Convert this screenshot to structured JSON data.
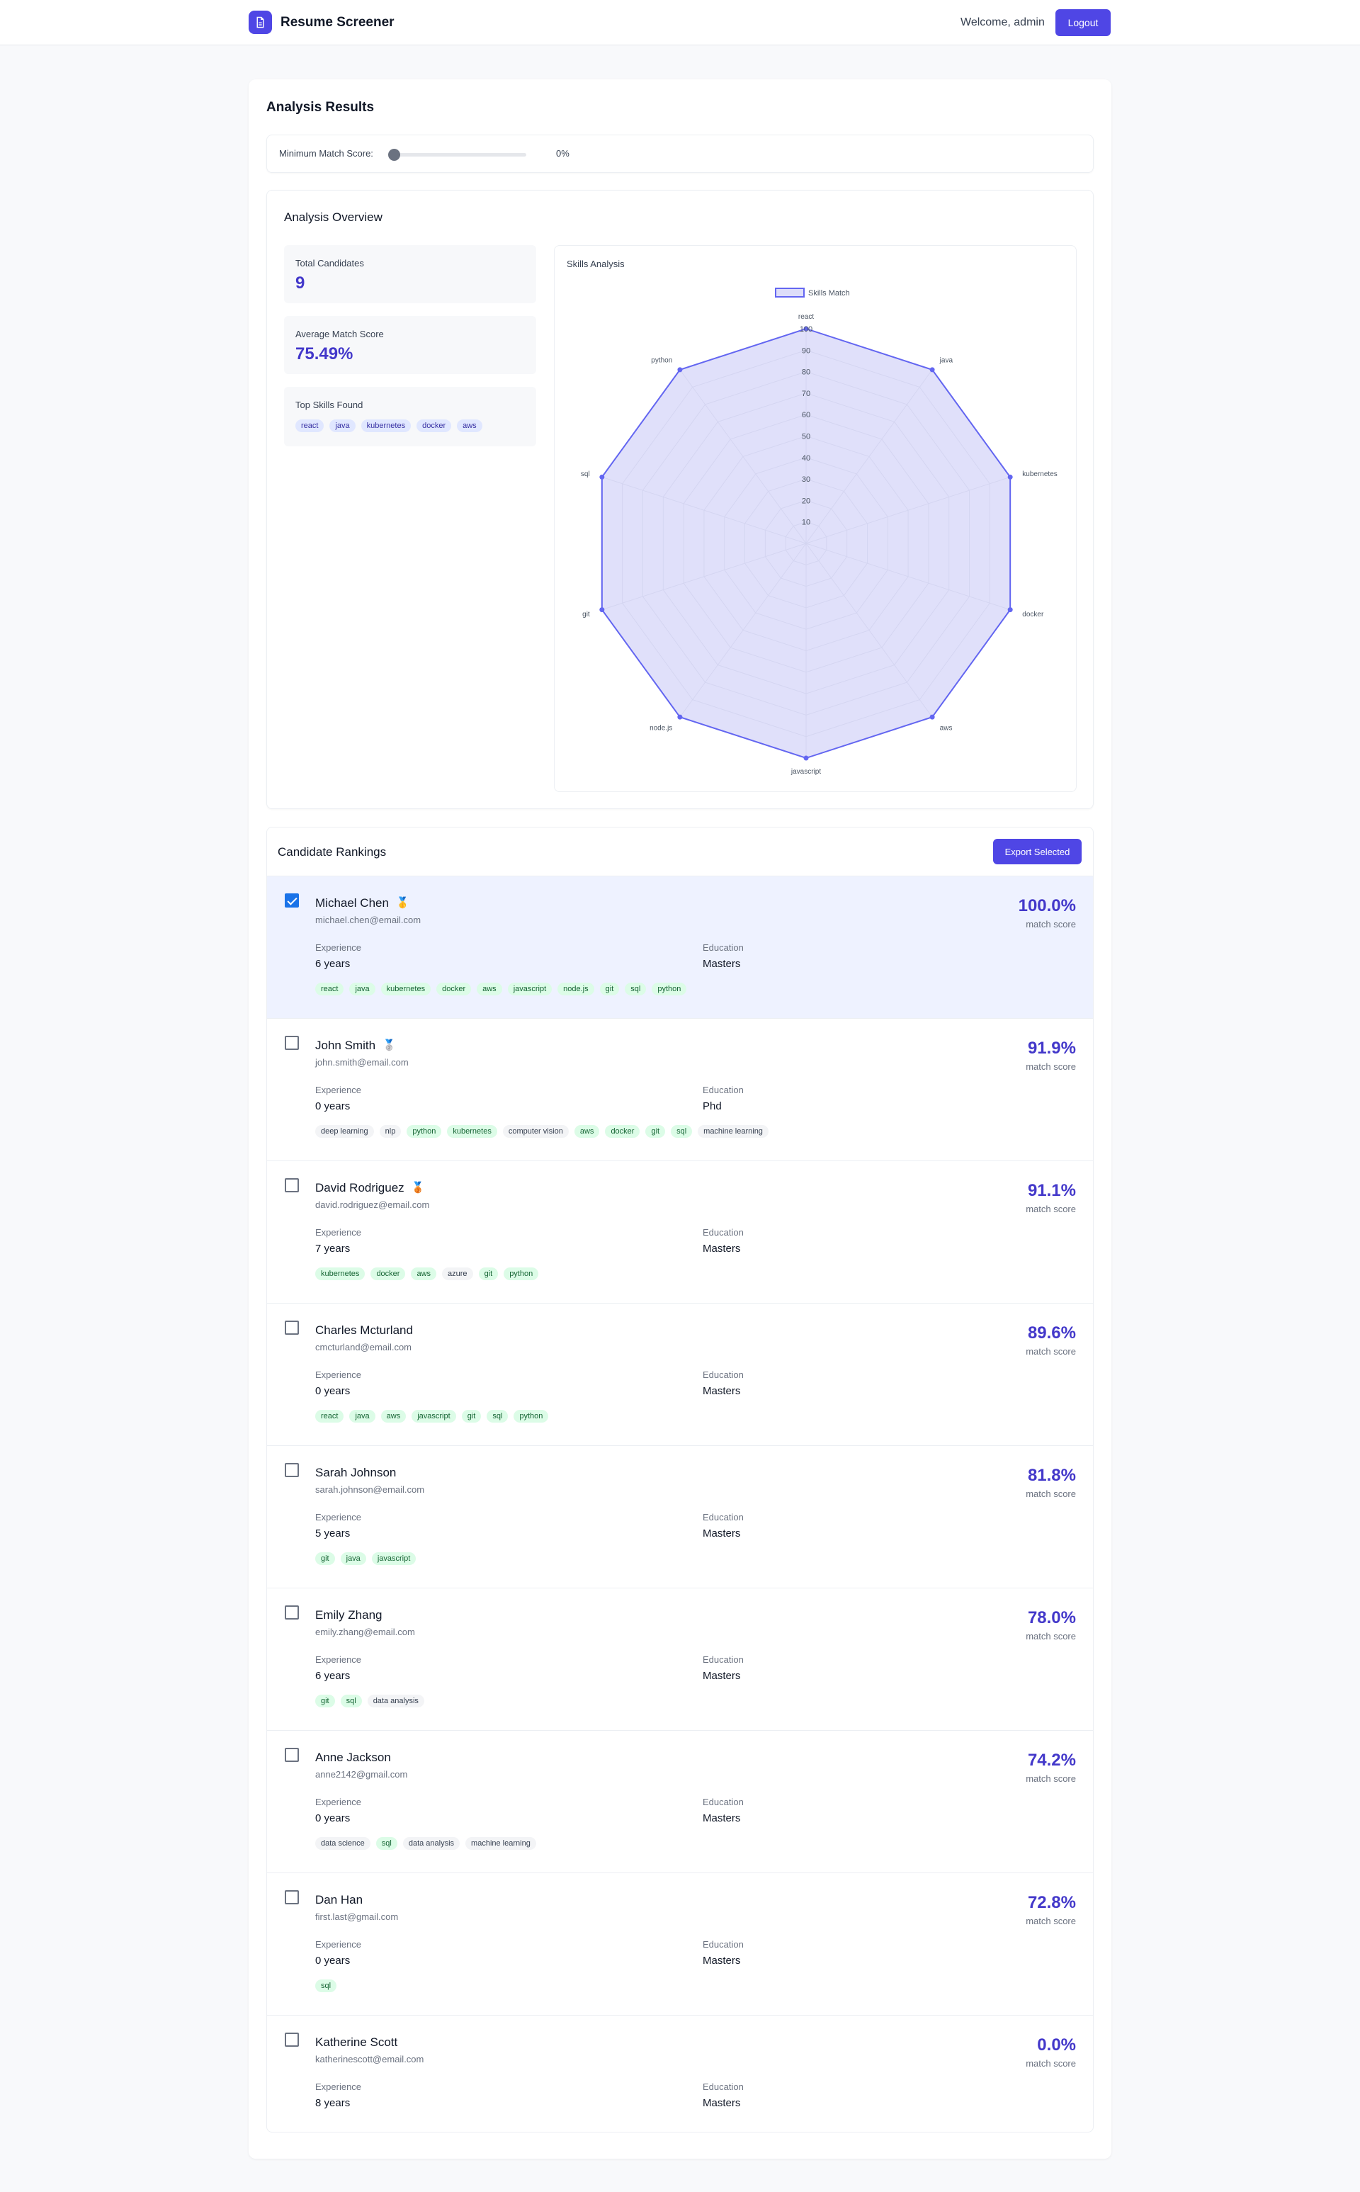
{
  "header": {
    "app_name": "Resume Screener",
    "welcome": "Welcome, admin",
    "logout_label": "Logout"
  },
  "main": {
    "title": "Analysis Results"
  },
  "filter": {
    "label": "Minimum Match Score:",
    "value_text": "0%",
    "value": 0
  },
  "overview": {
    "title": "Analysis Overview",
    "total_label": "Total Candidates",
    "total_value": "9",
    "avg_label": "Average Match Score",
    "avg_value": "75.49%",
    "skills_label": "Top Skills Found",
    "top_skills": [
      "react",
      "java",
      "kubernetes",
      "docker",
      "aws"
    ]
  },
  "chart_title": "Skills Analysis",
  "chart_data": {
    "type": "radar",
    "categories": [
      "react",
      "java",
      "kubernetes",
      "docker",
      "aws",
      "javascript",
      "node.js",
      "git",
      "sql",
      "python"
    ],
    "series": [
      {
        "name": "Skills Match",
        "values": [
          100,
          100,
          100,
          100,
          100,
          100,
          100,
          100,
          100,
          100
        ]
      }
    ],
    "ticks": [
      "10",
      "20",
      "30",
      "40",
      "50",
      "60",
      "70",
      "80",
      "90",
      "100"
    ],
    "rlim": [
      0,
      100
    ],
    "legend": "top",
    "colors": {
      "fill": "#c7c7f5",
      "line": "#6366f1"
    }
  },
  "rankings": {
    "title": "Candidate Rankings",
    "export_label": "Export Selected",
    "experience_label": "Experience",
    "education_label": "Education",
    "score_label": "match score",
    "candidates": [
      {
        "name": "Michael Chen",
        "medal": "🥇",
        "email": "michael.chen@email.com",
        "experience": "6 years",
        "education": "Masters",
        "score": "100.0%",
        "selected": true,
        "skills": [
          [
            "react",
            "match"
          ],
          [
            "java",
            "match"
          ],
          [
            "kubernetes",
            "match"
          ],
          [
            "docker",
            "match"
          ],
          [
            "aws",
            "match"
          ],
          [
            "javascript",
            "match"
          ],
          [
            "node.js",
            "match"
          ],
          [
            "git",
            "match"
          ],
          [
            "sql",
            "match"
          ],
          [
            "python",
            "match"
          ]
        ]
      },
      {
        "name": "John Smith",
        "medal": "🥈",
        "email": "john.smith@email.com",
        "experience": "0 years",
        "education": "Phd",
        "score": "91.9%",
        "selected": false,
        "skills": [
          [
            "deep learning",
            "other"
          ],
          [
            "nlp",
            "other"
          ],
          [
            "python",
            "match"
          ],
          [
            "kubernetes",
            "match"
          ],
          [
            "computer vision",
            "other"
          ],
          [
            "aws",
            "match"
          ],
          [
            "docker",
            "match"
          ],
          [
            "git",
            "match"
          ],
          [
            "sql",
            "match"
          ],
          [
            "machine learning",
            "other"
          ]
        ]
      },
      {
        "name": "David Rodriguez",
        "medal": "🥉",
        "email": "david.rodriguez@email.com",
        "experience": "7 years",
        "education": "Masters",
        "score": "91.1%",
        "selected": false,
        "skills": [
          [
            "kubernetes",
            "match"
          ],
          [
            "docker",
            "match"
          ],
          [
            "aws",
            "match"
          ],
          [
            "azure",
            "other"
          ],
          [
            "git",
            "match"
          ],
          [
            "python",
            "match"
          ]
        ]
      },
      {
        "name": "Charles Mcturland",
        "medal": "",
        "email": "cmcturland@email.com",
        "experience": "0 years",
        "education": "Masters",
        "score": "89.6%",
        "selected": false,
        "skills": [
          [
            "react",
            "match"
          ],
          [
            "java",
            "match"
          ],
          [
            "aws",
            "match"
          ],
          [
            "javascript",
            "match"
          ],
          [
            "git",
            "match"
          ],
          [
            "sql",
            "match"
          ],
          [
            "python",
            "match"
          ]
        ]
      },
      {
        "name": "Sarah Johnson",
        "medal": "",
        "email": "sarah.johnson@email.com",
        "experience": "5 years",
        "education": "Masters",
        "score": "81.8%",
        "selected": false,
        "skills": [
          [
            "git",
            "match"
          ],
          [
            "java",
            "match"
          ],
          [
            "javascript",
            "match"
          ]
        ]
      },
      {
        "name": "Emily Zhang",
        "medal": "",
        "email": "emily.zhang@email.com",
        "experience": "6 years",
        "education": "Masters",
        "score": "78.0%",
        "selected": false,
        "skills": [
          [
            "git",
            "match"
          ],
          [
            "sql",
            "match"
          ],
          [
            "data analysis",
            "other"
          ]
        ]
      },
      {
        "name": "Anne Jackson",
        "medal": "",
        "email": "anne2142@gmail.com",
        "experience": "0 years",
        "education": "Masters",
        "score": "74.2%",
        "selected": false,
        "skills": [
          [
            "data science",
            "other"
          ],
          [
            "sql",
            "match"
          ],
          [
            "data analysis",
            "other"
          ],
          [
            "machine learning",
            "other"
          ]
        ]
      },
      {
        "name": "Dan Han",
        "medal": "",
        "email": "first.last@gmail.com",
        "experience": "0 years",
        "education": "Masters",
        "score": "72.8%",
        "selected": false,
        "skills": [
          [
            "sql",
            "match"
          ]
        ]
      },
      {
        "name": "Katherine Scott",
        "medal": "",
        "email": "katherinescott@email.com",
        "experience": "8 years",
        "education": "Masters",
        "score": "0.0%",
        "selected": false,
        "skills": []
      }
    ]
  }
}
